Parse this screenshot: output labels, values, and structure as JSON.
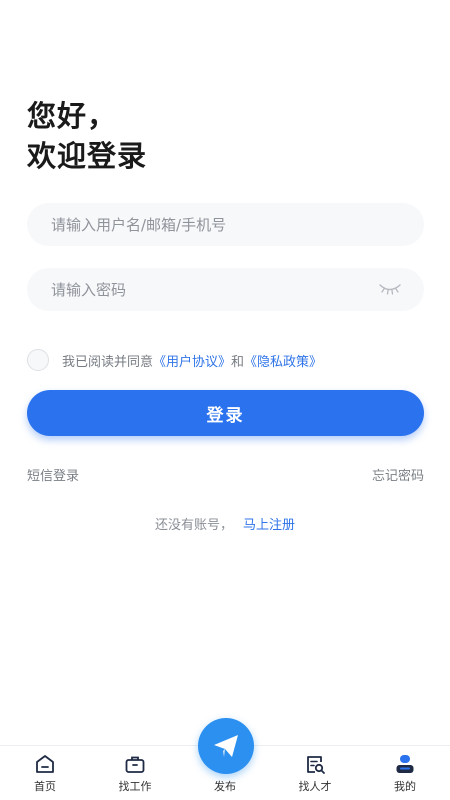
{
  "greeting": {
    "line1": "您好，",
    "line2": "欢迎登录"
  },
  "form": {
    "username_placeholder": "请输入用户名/邮箱/手机号",
    "password_placeholder": "请输入密码",
    "password_toggle_icon": "eye-closed-icon"
  },
  "agreement": {
    "checked": false,
    "prefix": "我已阅读并同意",
    "user_agreement": "《用户协议》",
    "and": "和",
    "privacy_policy": "《隐私政策》"
  },
  "login_button": "登录",
  "links": {
    "sms_login": "短信登录",
    "forgot_password": "忘记密码"
  },
  "register": {
    "prompt": "还没有账号，",
    "action": "马上注册"
  },
  "tabbar": {
    "items": [
      {
        "label": "首页",
        "icon": "home-icon"
      },
      {
        "label": "找工作",
        "icon": "briefcase-icon"
      },
      {
        "label": "发布",
        "icon": "paper-plane-icon"
      },
      {
        "label": "找人才",
        "icon": "resume-search-icon"
      },
      {
        "label": "我的",
        "icon": "user-icon"
      }
    ],
    "active_index": 4
  },
  "colors": {
    "primary": "#2b72ee",
    "link": "#2f74e8",
    "fab": "#2b90f0"
  }
}
